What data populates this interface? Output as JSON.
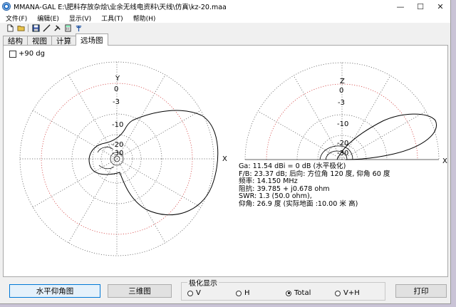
{
  "window": {
    "title": "MMANA-GAL E:\\肥料存放杂烩\\业余无线电资料\\天线\\仿真\\kz-20.maa",
    "controls": {
      "minimize": "—",
      "maximize": "☐",
      "close": "✕"
    }
  },
  "menu": [
    "文件(F)",
    "编辑(E)",
    "显示(V)",
    "工具(T)",
    "帮助(H)"
  ],
  "toolbar": [
    "new-file-icon",
    "open-folder-icon",
    "save-icon",
    "wire-tool-icon",
    "tools-icon",
    "calculator-icon",
    "antenna-icon"
  ],
  "tabs": [
    {
      "label": "结构",
      "active": false
    },
    {
      "label": "视图",
      "active": false
    },
    {
      "label": "计算",
      "active": false
    },
    {
      "label": "远场图",
      "active": true
    }
  ],
  "panel": {
    "checkbox_label": "+90 dg",
    "left_plot": {
      "axis_y": "Y",
      "axis_x": "X",
      "rings": [
        "0",
        "-3",
        "-10",
        "-20",
        "-30"
      ]
    },
    "right_plot": {
      "axis_z": "Z",
      "axis_x": "X",
      "rings": [
        "0",
        "-3",
        "-10",
        "-20",
        "-30"
      ]
    },
    "info_lines": [
      "Ga: 11.54 dBi = 0 dB  (水平极化)",
      "F/B: 23.37 dB; 后向: 方位角 120 度,  仰角 60 度",
      "频率: 14.150 MHz",
      "阻抗: 39.785 + j0.678 ohm",
      "SWR: 1.3 (50.0 ohm),",
      "仰角: 26.9 度 (实际地面  :10.00 米 高)"
    ]
  },
  "bottom": {
    "buttons": {
      "horizontal_elevation": "水平仰角图",
      "three_d": "三维图",
      "print": "打印"
    },
    "polarization": {
      "title": "极化显示",
      "options": [
        {
          "label": "V",
          "selected": false
        },
        {
          "label": "H",
          "selected": false
        },
        {
          "label": "Total",
          "selected": true
        },
        {
          "label": "V+H",
          "selected": false
        }
      ]
    }
  },
  "colors": {
    "grid_black": "#555555",
    "grid_red": "#d03030",
    "pattern": "#000000",
    "window_bg": "#f0f0f0"
  }
}
